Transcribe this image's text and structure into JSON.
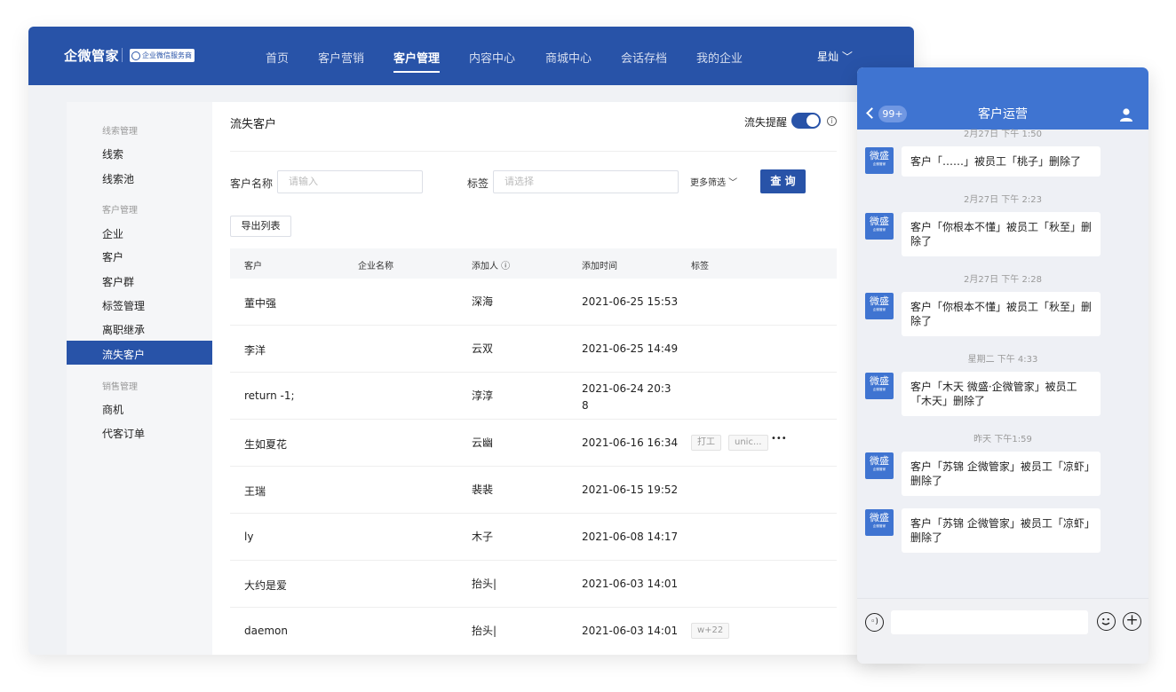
{
  "header": {
    "logo": "企微管家",
    "badge": "企业微信服务商",
    "nav": [
      {
        "label": "首页"
      },
      {
        "label": "客户营销"
      },
      {
        "label": "客户管理"
      },
      {
        "label": "内容中心"
      },
      {
        "label": "商城中心"
      },
      {
        "label": "会话存档"
      },
      {
        "label": "我的企业"
      }
    ],
    "active_nav": "客户管理",
    "user": "星灿 ﹀"
  },
  "sidebar": {
    "groups": [
      {
        "title": "线索管理",
        "items": [
          "线索",
          "线索池"
        ]
      },
      {
        "title": "客户管理",
        "items": [
          "企业",
          "客户",
          "客户群",
          "标签管理",
          "离职继承",
          "流失客户"
        ]
      },
      {
        "title": "销售管理",
        "items": [
          "商机",
          "代客订单"
        ]
      }
    ],
    "active": "流失客户"
  },
  "main": {
    "title": "流失客户",
    "alert_label": "流失提醒",
    "alert_on": true,
    "filters": {
      "name_label": "客户名称",
      "name_placeholder": "请输入",
      "tag_label": "标签",
      "tag_placeholder": "请选择",
      "more": "更多筛选 ﹀",
      "query": "查 询"
    },
    "export": "导出列表",
    "columns": [
      "客户",
      "企业名称",
      "添加人 ⓘ",
      "添加时间",
      "标签"
    ],
    "rows": [
      {
        "customer": "董中强",
        "company": "",
        "adder": "深海",
        "time": "2021-06-25 15:53",
        "tags": []
      },
      {
        "customer": "李洋",
        "company": "",
        "adder": "云双",
        "time": "2021-06-25 14:49",
        "tags": []
      },
      {
        "customer": "return -1;",
        "company": "",
        "adder": "淳淳",
        "time": "2021-06-24 20:3\n8",
        "tags": []
      },
      {
        "customer": "生如夏花",
        "company": "",
        "adder": "云幽",
        "time": "2021-06-16 16:34",
        "tags": [
          "打工",
          "unic..."
        ],
        "more": "•••"
      },
      {
        "customer": "王瑞",
        "company": "",
        "adder": "裴裴",
        "time": "2021-06-15 19:52",
        "tags": []
      },
      {
        "customer": "ly",
        "company": "",
        "adder": "木子",
        "time": "2021-06-08 14:17",
        "tags": []
      },
      {
        "customer": "大约是爱",
        "company": "",
        "adder": "抬头|",
        "time": "2021-06-03 14:01",
        "tags": []
      },
      {
        "customer": "daemon",
        "company": "",
        "adder": "抬头|",
        "time": "2021-06-03 14:01",
        "tags": [
          "w+22"
        ]
      }
    ]
  },
  "chat": {
    "unread": "99+",
    "title": "客户运营",
    "avatar_main": "微盛",
    "avatar_sub": "企微管家",
    "top_timestamp": "2月27日 下午 1:50",
    "messages": [
      {
        "time": "",
        "text": "客户「……」被员工「桃子」删除了"
      },
      {
        "time": "2月27日 下午 2:23",
        "text": "客户「你根本不懂」被员工「秋至」删除了"
      },
      {
        "time": "2月27日 下午 2:28",
        "text": "客户「你根本不懂」被员工「秋至」删除了"
      },
      {
        "time": "星期二 下午 4:33",
        "text": "客户「木天 微盛·企微管家」被员工「木天」删除了"
      },
      {
        "time": "昨天 下午1:59",
        "text": "客户「苏锦 企微管家」被员工「凉虾」删除了"
      },
      {
        "time": "",
        "text": "客户「苏锦 企微管家」被员工「凉虾」删除了"
      }
    ]
  },
  "colors": {
    "brand": "#2853a8",
    "chat_header": "#3f74d1"
  }
}
